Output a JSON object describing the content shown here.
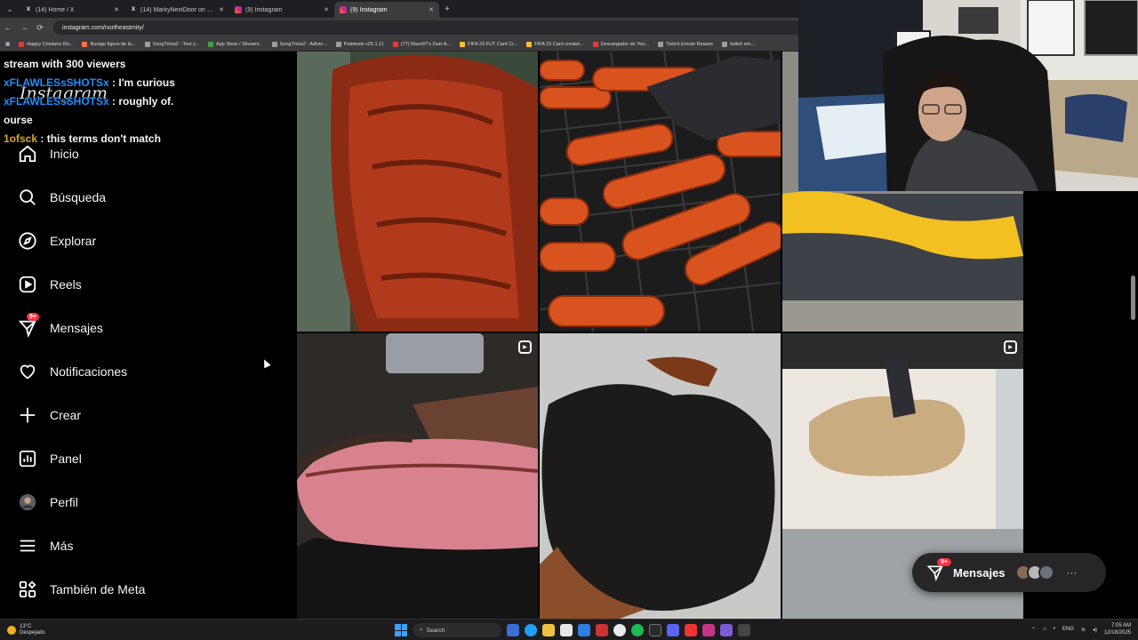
{
  "browser": {
    "tabs": [
      {
        "label": "(14) Home / X",
        "icon": "x-icon",
        "active": false
      },
      {
        "label": "(14) MarkyNextDoor on X: \"My",
        "icon": "x-icon",
        "active": false
      },
      {
        "label": "(9) Instagram",
        "icon": "instagram-icon",
        "active": false
      },
      {
        "label": "(9) Instagram",
        "icon": "instagram-icon",
        "active": true
      }
    ],
    "new_tab": "+",
    "url": "instagram.com/northeastmity/",
    "bookmarks": [
      {
        "label": "Happy Cristiano Ro...",
        "color": "#e53935"
      },
      {
        "label": "Burago figura de la...",
        "color": "#ff7043"
      },
      {
        "label": "SongTrivia2 - Test y...",
        "color": "#9e9e9e"
      },
      {
        "label": "App Store / Streami...",
        "color": "#43a047"
      },
      {
        "label": "SongTrivia2 - Adivin...",
        "color": "#9e9e9e"
      },
      {
        "label": "Paletools v25.1.11",
        "color": "#9e9e9e"
      },
      {
        "label": "(77) Razo97's Zest-A...",
        "color": "#e53935"
      },
      {
        "label": "FIFA 23 FUT Card Cr...",
        "color": "#fbc02d"
      },
      {
        "label": "FIFA 23 Card creator...",
        "color": "#fbc02d"
      },
      {
        "label": "Descargador de You...",
        "color": "#e53935"
      },
      {
        "label": "Twitch Emote Resizer",
        "color": "#9e9e9e"
      },
      {
        "label": "twitch em...",
        "color": "#9e9e9e"
      }
    ]
  },
  "chat": [
    {
      "user": "",
      "text": "stream with 300 viewers"
    },
    {
      "user": "xFLAWLESsSHOTSx",
      "text": ": I'm curious"
    },
    {
      "user": "xFLAWLESsSHOTSx",
      "text": ": roughly of."
    },
    {
      "user": "",
      "text": "ourse"
    },
    {
      "user": "1ofsck",
      "text": ": this terms don't match"
    }
  ],
  "instagram": {
    "logo": "Instagram",
    "nav": [
      {
        "label": "Inicio",
        "icon": "home-icon"
      },
      {
        "label": "Búsqueda",
        "icon": "search-icon"
      },
      {
        "label": "Explorar",
        "icon": "compass-icon"
      },
      {
        "label": "Reels",
        "icon": "reels-icon"
      },
      {
        "label": "Mensajes",
        "icon": "messenger-icon",
        "badge": "9+"
      },
      {
        "label": "Notificaciones",
        "icon": "heart-icon"
      },
      {
        "label": "Crear",
        "icon": "plus-icon"
      },
      {
        "label": "Panel",
        "icon": "dashboard-icon"
      },
      {
        "label": "Perfil",
        "icon": "avatar-icon"
      },
      {
        "label": "Más",
        "icon": "menu-icon"
      },
      {
        "label": "También de Meta",
        "icon": "meta-apps-icon"
      }
    ],
    "messages_pill": {
      "label": "Mensajes",
      "badge": "9+",
      "more": "···"
    }
  },
  "taskbar": {
    "weather_temp": "13°C",
    "weather_desc": "Despejado",
    "search_placeholder": "Search",
    "lang": "ENG",
    "time": "7:05 AM",
    "date": "12/18/2025"
  }
}
